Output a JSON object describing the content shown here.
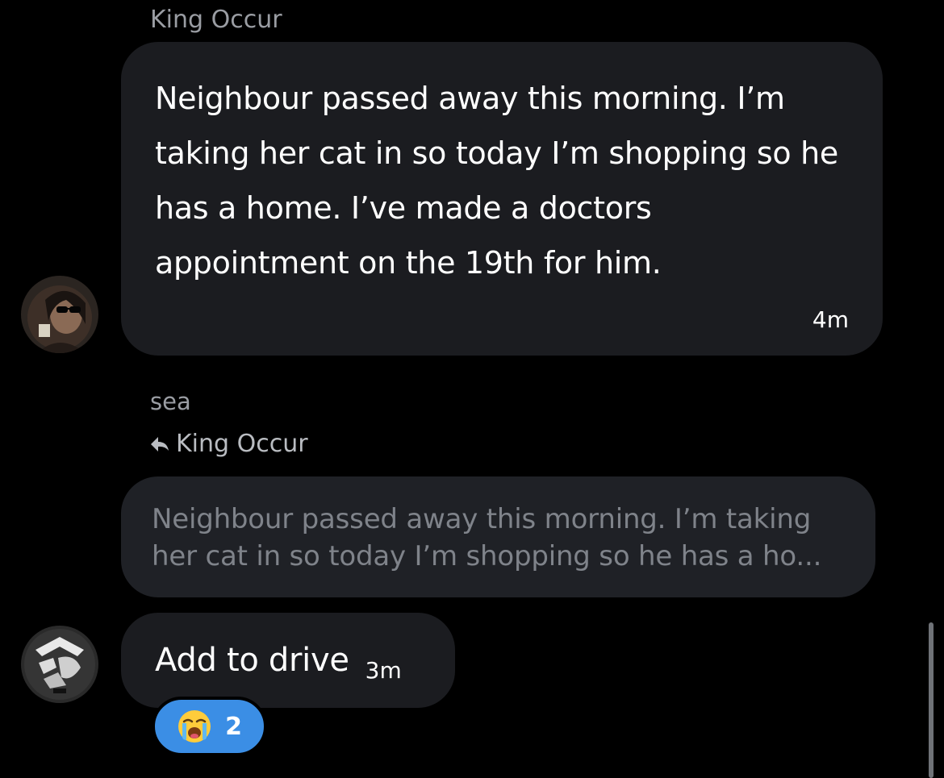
{
  "messages": [
    {
      "sender": "King Occur",
      "text": "Neighbour passed away this morning. I’m taking her cat in so today I’m shopping so he has a home. I’ve made a doctors appointment on the 19th for him.",
      "time": "4m",
      "avatar_icon": "user-avatar-sunglasses"
    },
    {
      "sender": "sea",
      "reply_to": "King Occur",
      "quoted_text": "Neighbour passed away this morning. I’m taking her cat in so today I’m shopping so he has a ho...",
      "text": "Add to drive",
      "time": "3m",
      "avatar_icon": "sea-logo-avatar",
      "reaction": {
        "emoji_icon": "loudly-crying-face-icon",
        "count": "2"
      }
    }
  ],
  "colors": {
    "background": "#000000",
    "bubble": "#1b1c20",
    "quote_bubble": "#1f2126",
    "reaction_accent": "#3b8ee5",
    "muted_text": "#9a9da3"
  }
}
